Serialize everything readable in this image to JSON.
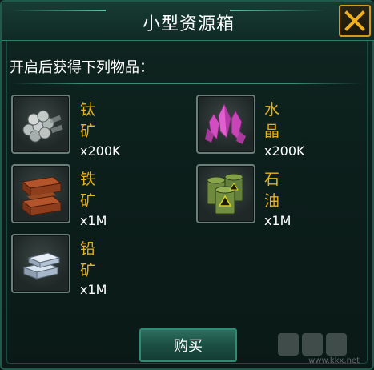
{
  "dialog": {
    "title": "小型资源箱",
    "subtitle": "开启后获得下列物品：",
    "buy_label": "购买",
    "close_icon": "close-x-icon"
  },
  "items": [
    {
      "name": "钛矿",
      "qty": "x200K",
      "icon": "titanium-bars-icon"
    },
    {
      "name": "水晶",
      "qty": "x200K",
      "icon": "crystal-icon"
    },
    {
      "name": "铁矿",
      "qty": "x1M",
      "icon": "iron-block-icon"
    },
    {
      "name": "石油",
      "qty": "x1M",
      "icon": "oil-barrels-icon"
    },
    {
      "name": "铅矿",
      "qty": "x1M",
      "icon": "lead-ingots-icon"
    }
  ],
  "watermark": {
    "text": "www.kkx.net"
  },
  "colors": {
    "accent_gold": "#e8b21a",
    "border_teal": "#2e8b74",
    "close_orange": "#d49a16"
  }
}
